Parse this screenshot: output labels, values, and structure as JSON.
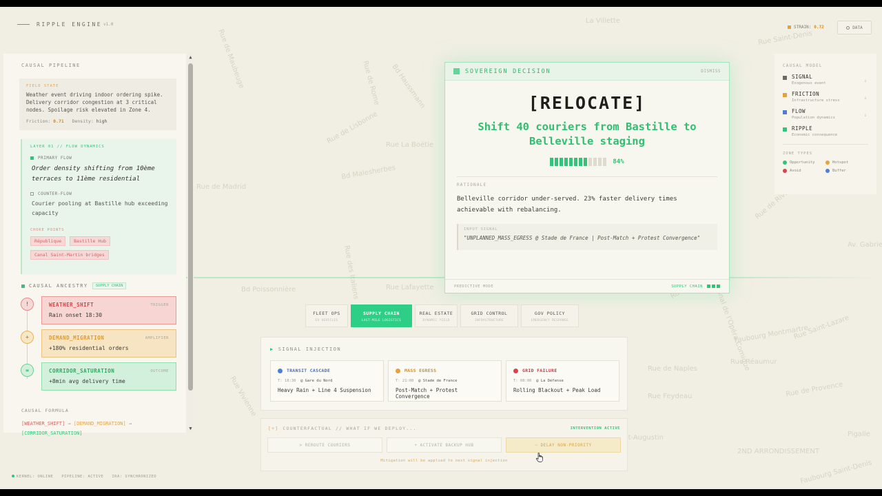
{
  "header": {
    "brand": "RIPPLE ENGINE",
    "version": "v1.0",
    "strain_label": "STRAIN:",
    "strain_value": "0.72",
    "data_button": "DATA"
  },
  "map_labels": [
    "La Villette",
    "Rue de Maubeuge",
    "Rue de Rome",
    "Bd Haussmann",
    "Rue La Boétie",
    "Rue de Lisbonne",
    "Rue de Madrid",
    "Bd Malesherbes",
    "Rue de Rivoli",
    "Rue Lafayette",
    "Bd Poissonnière",
    "Rue des Italiens",
    "Faubourg Montmartre",
    "Rue Saint-Lazare",
    "Rue Réaumur",
    "Rue Feydeau",
    "Rue de Provence",
    "Av. Gabriel",
    "Rue Marbeuf",
    "Rue Vivienne",
    "Saint-Augustin",
    "2ND ARRONDISSEMENT",
    "Faubourg Saint-Denis",
    "Pigalle",
    "Rue de Naples",
    "Théâtre National de l'Opéra Comique",
    "Rue Saint-Denis"
  ],
  "left_panel": {
    "title": "CAUSAL PIPELINE",
    "field_state": {
      "label": "FIELD STATE",
      "text": "Weather event driving indoor ordering spike. Delivery corridor congestion at 3 critical nodes. Spoilage risk elevated in Zone 4.",
      "friction_label": "Friction:",
      "friction_value": "0.71",
      "density_label": "Density:",
      "density_value": "high"
    },
    "layer": {
      "title": "LAYER 01 // FLOW DYNAMICS",
      "primary_label": "PRIMARY FLOW",
      "primary_text": "Order density shifting from 10ème terraces to 11ème residential",
      "counter_label": "COUNTER-FLOW",
      "counter_text": "Courier pooling at Bastille hub exceeding capacity",
      "choke_label": "CHOKE POINTS",
      "choke_points": [
        "République",
        "Bastille Hub",
        "Canal Saint-Martin bridges"
      ]
    },
    "ancestry": {
      "title": "CAUSAL ANCESTRY",
      "badge": "SUPPLY CHAIN",
      "events": [
        {
          "symbol": "!",
          "name": "WEATHER_SHIFT",
          "role": "TRIGGER",
          "desc": "Rain onset 18:30"
        },
        {
          "symbol": "+",
          "name": "DEMAND_MIGRATION",
          "role": "AMPLIFIER",
          "desc": "+180% residential orders"
        },
        {
          "symbol": "=",
          "name": "CORRIDOR_SATURATION",
          "role": "OUTCOME",
          "desc": "+8min avg delivery time"
        }
      ]
    },
    "formula": {
      "title": "CAUSAL FORMULA",
      "a": "[WEATHER_SHIFT]",
      "b": "[DEMAND_MIGRATION]",
      "c": "[CORRIDOR_SATURATION]",
      "arrow": "→"
    }
  },
  "status_bar": {
    "kernel": "KERNEL: ONLINE",
    "pipeline": "PIPELINE: ACTIVE",
    "ira": "IRA: SYNCHRONIZED"
  },
  "decision": {
    "title": "SOVEREIGN DECISION",
    "dismiss": "DISMISS",
    "action": "[RELOCATE]",
    "headline": "Shift 40 couriers from Bastille to Belleville staging",
    "confidence": 0.84,
    "confidence_label": "84%",
    "rationale_label": "RATIONALE",
    "rationale": "Belleville corridor under-served. 23% faster delivery times achievable with rebalancing.",
    "input_label": "INPUT SIGNAL",
    "input_signal": "\"UNPLANNED_MASS_EGRESS @ Stade de France | Post-Match + Protest Convergence\"",
    "mode": "PREDICTIVE MODE",
    "footer_tag": "SUPPLY CHAIN"
  },
  "causal_model": {
    "title": "CAUSAL MODEL",
    "layers": [
      {
        "name": "SIGNAL",
        "sub": "Exogenous event",
        "color": "#6b6b66"
      },
      {
        "name": "FRICTION",
        "sub": "Infrastructure stress",
        "color": "#e8a13a"
      },
      {
        "name": "FLOW",
        "sub": "Population dynamics",
        "color": "#4a7fd4"
      },
      {
        "name": "RIPPLE",
        "sub": "Economic consequence",
        "color": "#35c27a"
      }
    ],
    "zone_title": "ZONE TYPES",
    "zones": [
      {
        "name": "Opportunity",
        "color": "#35c27a"
      },
      {
        "name": "Hotspot",
        "color": "#e8a13a"
      },
      {
        "name": "Avoid",
        "color": "#d9434e"
      },
      {
        "name": "Buffer",
        "color": "#4a7fd4"
      }
    ]
  },
  "tabs": [
    {
      "name": "FLEET OPS",
      "sub": "EV VEHICLES",
      "active": false
    },
    {
      "name": "SUPPLY CHAIN",
      "sub": "LAST-MILE LOGISTICS",
      "active": true
    },
    {
      "name": "REAL ESTATE",
      "sub": "DYNAMIC YIELD",
      "active": false
    },
    {
      "name": "GRID CONTROL",
      "sub": "INFRASTRUCTURE",
      "active": false
    },
    {
      "name": "GOV POLICY",
      "sub": "EMERGENCY RESPONSE",
      "active": false
    }
  ],
  "signal_injection": {
    "title": "SIGNAL INJECTION",
    "scenarios": [
      {
        "name": "TRANSIT CASCADE",
        "color": "#4a7fd4",
        "time": "T: 18:30",
        "place": "@ Gare du Nord",
        "desc": "Heavy Rain + Line 4 Suspension"
      },
      {
        "name": "MASS EGRESS",
        "color": "#e8a13a",
        "time": "T: 21:00",
        "place": "@ Stade de France",
        "desc": "Post-Match + Protest Convergence"
      },
      {
        "name": "GRID FAILURE",
        "color": "#d9434e",
        "time": "T: 08:00",
        "place": "@ La Défense",
        "desc": "Rolling Blackout + Peak Load"
      }
    ]
  },
  "counterfactual": {
    "prefix": "[+]",
    "title": "COUNTERFACTUAL // WHAT IF WE DEPLOY...",
    "status": "INTERVENTION ACTIVE",
    "options": [
      "> REROUTE COURIERS",
      "+ ACTIVATE BACKUP HUB",
      "~ DELAY NON-PRIORITY"
    ],
    "note": "Mitigation will be applied to next signal injection"
  }
}
